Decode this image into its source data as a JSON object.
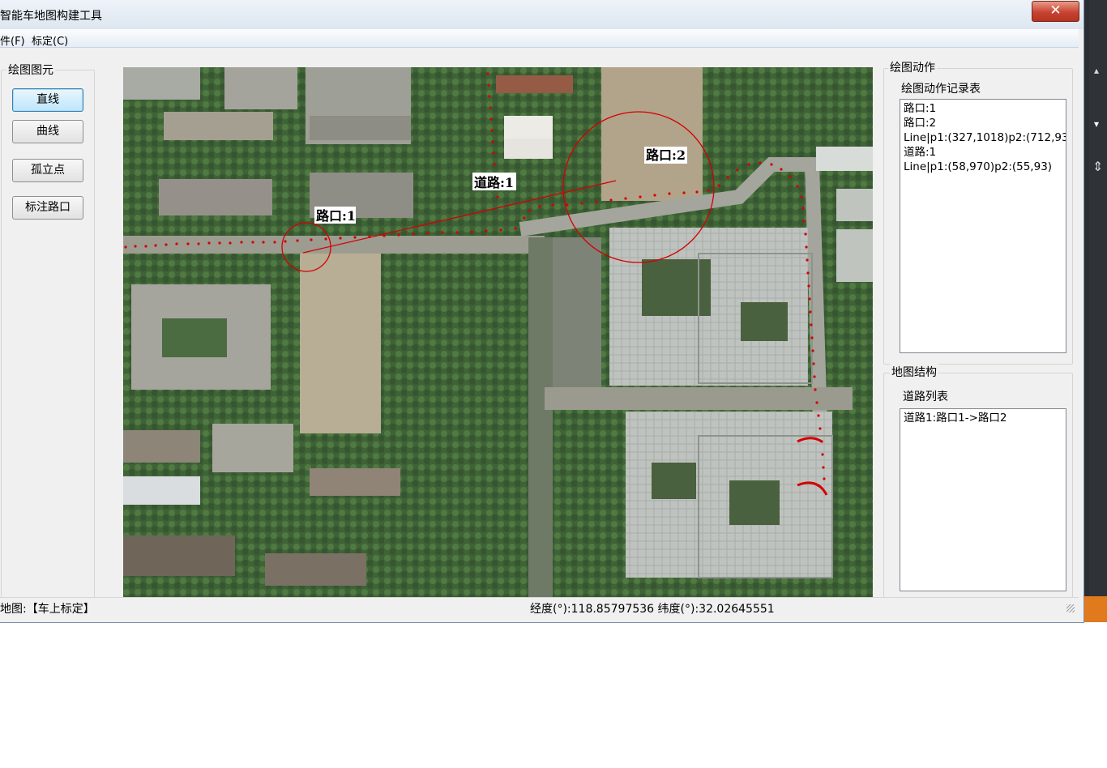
{
  "window": {
    "title": "智能车地图构建工具",
    "close_glyph": "✕"
  },
  "menu": [
    {
      "label": "件(F)"
    },
    {
      "label": "标定(C)"
    }
  ],
  "left_panel": {
    "group_title": "绘图图元",
    "buttons": [
      {
        "label": "直线",
        "selected": true
      },
      {
        "label": "曲线",
        "selected": false
      },
      {
        "label": "孤立点",
        "selected": false
      },
      {
        "label": "标注路口",
        "selected": false
      }
    ]
  },
  "map": {
    "labels": {
      "junction1": "路口:1",
      "junction2": "路口:2",
      "road1": "道路:1"
    },
    "overlay_color": "#d40000"
  },
  "right_panel": {
    "actions_group_title": "绘图动作",
    "actions_list_title": "绘图动作记录表",
    "actions": [
      "路口:1",
      "路口:2",
      "Line|p1:(327,1018)p2:(712,93",
      "道路:1",
      "Line|p1:(58,970)p2:(55,93)"
    ],
    "structure_group_title": "地图结构",
    "roads_list_title": "道路列表",
    "roads": [
      "道路1:路口1->路口2"
    ]
  },
  "status": {
    "map_label": "地图:【车上标定】",
    "coords": "经度(°):118.85797536 纬度(°):32.02645551"
  },
  "right_strip": {
    "icons": [
      "scroll-up-icon",
      "scroll-down-icon",
      "split-icon"
    ]
  }
}
